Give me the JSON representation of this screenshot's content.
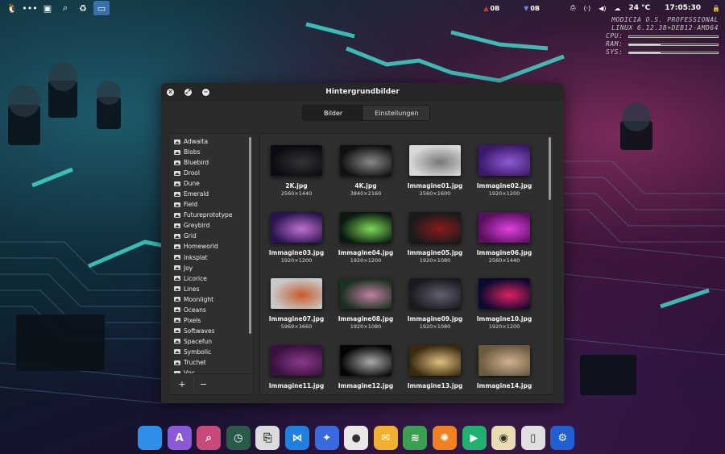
{
  "topbar": {
    "left_icons": [
      "tux-icon",
      "dots-icon",
      "screenshot-icon",
      "search-icon",
      "recycle-icon",
      "wallpaper-app-icon"
    ],
    "net_down": "0B",
    "net_up": "0B",
    "temperature": "24 °C",
    "clock": "17:05:30"
  },
  "sysinfo": {
    "line1": "MODICIA O.S. PROFESSIONAL",
    "line2": "LINUX 6.12.38+DEB12-AMD64",
    "rows": [
      {
        "label": "CPU:",
        "level": 0.0
      },
      {
        "label": "RAM:",
        "level": 0.35
      },
      {
        "label": "SYS:",
        "level": 0.35
      }
    ]
  },
  "window": {
    "title": "Hintergrundbilder",
    "tabs": [
      {
        "label": "Bilder",
        "active": true
      },
      {
        "label": "Einstellungen",
        "active": false
      }
    ],
    "sidebar_items": [
      "Adwaita",
      "Blobs",
      "Bluebird",
      "Drool",
      "Dune",
      "Emerald",
      "Field",
      "Futureprototype",
      "Greybird",
      "Grid",
      "Homeworld",
      "Inksplat",
      "Joy",
      "Licorice",
      "Lines",
      "Moonlight",
      "Oceans",
      "Pixels",
      "Softwaves",
      "Spacefun",
      "Symbolic",
      "Truchet",
      "Vnc"
    ],
    "add_label": "+",
    "remove_label": "−",
    "images": [
      {
        "name": "2K.jpg",
        "res": "2560×1440",
        "colors": [
          "#0a0a12",
          "#333"
        ]
      },
      {
        "name": "4K.jpg",
        "res": "3840×2160",
        "colors": [
          "#111",
          "#888"
        ]
      },
      {
        "name": "Immagine01.jpg",
        "res": "2560×1600",
        "colors": [
          "#d8d8d8",
          "#777"
        ]
      },
      {
        "name": "Immagine02.jpg",
        "res": "1920×1200",
        "colors": [
          "#3b1a6e",
          "#8f5ad0"
        ]
      },
      {
        "name": "Immagine03.jpg",
        "res": "1920×1200",
        "colors": [
          "#2a1450",
          "#c070d0"
        ]
      },
      {
        "name": "Immagine04.jpg",
        "res": "1920×1200",
        "colors": [
          "#0a1a10",
          "#7ed957"
        ]
      },
      {
        "name": "Immagine05.jpg",
        "res": "1920×1080",
        "colors": [
          "#1a1a1a",
          "#8a1a1a"
        ]
      },
      {
        "name": "Immagine06.jpg",
        "res": "2560×1440",
        "colors": [
          "#5a1060",
          "#e040e0"
        ]
      },
      {
        "name": "Immagine07.jpg",
        "res": "5969×3660",
        "colors": [
          "#c8c8c8",
          "#c85a2a"
        ]
      },
      {
        "name": "Immagine08.jpg",
        "res": "1920×1080",
        "colors": [
          "#1a3020",
          "#c080a0"
        ]
      },
      {
        "name": "Immagine09.jpg",
        "res": "1920×1080",
        "colors": [
          "#1a1a20",
          "#606070"
        ]
      },
      {
        "name": "Immagine10.jpg",
        "res": "1920×1200",
        "colors": [
          "#0a0a30",
          "#e02060"
        ]
      },
      {
        "name": "Immagine11.jpg",
        "res": "",
        "colors": [
          "#3a1040",
          "#8a3a8a"
        ]
      },
      {
        "name": "Immagine12.jpg",
        "res": "",
        "colors": [
          "#050505",
          "#aaa"
        ]
      },
      {
        "name": "Immagine13.jpg",
        "res": "",
        "colors": [
          "#3a2a10",
          "#e0c080"
        ]
      },
      {
        "name": "Immagine14.jpg",
        "res": "",
        "colors": [
          "#6a5a40",
          "#d0b090"
        ]
      }
    ]
  },
  "dock": [
    {
      "name": "folder-icon",
      "bg": "#2f8fe8",
      "glyph": ""
    },
    {
      "name": "app-icon-purple",
      "bg": "#8a5ad8",
      "glyph": "A"
    },
    {
      "name": "image-viewer-icon",
      "bg": "#c84a7a",
      "glyph": "⌕"
    },
    {
      "name": "clock-icon",
      "bg": "#2a5a48",
      "glyph": "◷"
    },
    {
      "name": "usb-writer-icon",
      "bg": "#dcdcdc",
      "glyph": "⎘"
    },
    {
      "name": "share-icon",
      "bg": "#2080e0",
      "glyph": "⋈"
    },
    {
      "name": "copilot-icon",
      "bg": "#3a6ae0",
      "glyph": "✦"
    },
    {
      "name": "chrome-icon",
      "bg": "#e8e8e8",
      "glyph": "●"
    },
    {
      "name": "mail-icon",
      "bg": "#f0b030",
      "glyph": "✉"
    },
    {
      "name": "layers-icon",
      "bg": "#3aa050",
      "glyph": "≋"
    },
    {
      "name": "xnview-icon",
      "bg": "#f08020",
      "glyph": "✺"
    },
    {
      "name": "media-player-icon",
      "bg": "#20b070",
      "glyph": "▶"
    },
    {
      "name": "speaker-icon",
      "bg": "#e8dcb0",
      "glyph": "◉"
    },
    {
      "name": "trash-icon",
      "bg": "#e0e0e0",
      "glyph": "▯"
    },
    {
      "name": "settings-icon",
      "bg": "#2060d0",
      "glyph": "⚙"
    }
  ]
}
